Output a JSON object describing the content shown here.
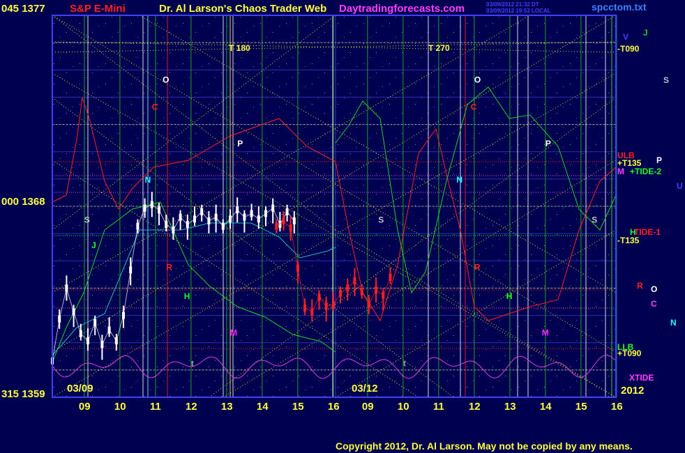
{
  "header": {
    "left_axis_top": "045  1377",
    "symbol": "S&P E-Mini",
    "title": "Dr. Al Larson's Chaos Trader Web",
    "site": "Daytradingforecasts.com",
    "stamp_line1": "03/09/2012 21:32 DT",
    "stamp_line2": "03/09/2012 19:53 LOCAL",
    "file": "spcctom.txt"
  },
  "axis": {
    "left_mid": "000  1368",
    "left_bottom": "315  1359",
    "date_left": "03/09",
    "date_mid": "03/12",
    "year": "2012",
    "hour_labels": [
      "09",
      "10",
      "11",
      "12",
      "13",
      "14",
      "15",
      "16",
      "09",
      "10",
      "11",
      "12",
      "13",
      "14",
      "15",
      "16"
    ]
  },
  "markers": {
    "t180": "T   180",
    "t270": "T   270"
  },
  "right_labels": {
    "v": "V",
    "j": "J",
    "t090_top": "-T090",
    "s": "S",
    "ulb": "ULB",
    "t135_pos": "+T135",
    "p": "P",
    "m": "M",
    "tide2": "+TIDE-2",
    "u": "U",
    "tide1": "TIDE-1",
    "h_right": "H",
    "t135_neg": "-T135",
    "r": "R",
    "o": "O",
    "c": "C",
    "n": "N",
    "llb": "LLB",
    "t090_bot": "+T090",
    "xtide": "XTIDE"
  },
  "chart_letters": [
    {
      "text": "O",
      "day": 1,
      "hour": 11.2,
      "price": 1374.8,
      "color": "#ffffff"
    },
    {
      "text": "C",
      "day": 1,
      "hour": 10.9,
      "price": 1373.3,
      "color": "#ff2020"
    },
    {
      "text": "P",
      "day": 1,
      "hour": 13.3,
      "price": 1371.3,
      "color": "#ffffff"
    },
    {
      "text": "N",
      "day": 1,
      "hour": 10.7,
      "price": 1369.3,
      "color": "#20ffff"
    },
    {
      "text": "S",
      "day": 1,
      "hour": 9.0,
      "price": 1367.1,
      "color": "#c0c0c0"
    },
    {
      "text": "J",
      "day": 1,
      "hour": 9.2,
      "price": 1365.7,
      "color": "#20ff20"
    },
    {
      "text": "R",
      "day": 1,
      "hour": 11.3,
      "price": 1364.5,
      "color": "#ff2020"
    },
    {
      "text": "H",
      "day": 1,
      "hour": 11.8,
      "price": 1362.9,
      "color": "#20ff20"
    },
    {
      "text": "M",
      "day": 1,
      "hour": 13.1,
      "price": 1360.9,
      "color": "#ff20ff"
    },
    {
      "text": "t",
      "day": 1,
      "hour": 12.0,
      "price": 1359.2,
      "color": "#a0a0a0"
    },
    {
      "text": "O",
      "day": 2,
      "hour": 12.0,
      "price": 1374.8,
      "color": "#ffffff"
    },
    {
      "text": "C",
      "day": 2,
      "hour": 11.9,
      "price": 1373.3,
      "color": "#ff2020"
    },
    {
      "text": "P",
      "day": 2,
      "hour": 14.0,
      "price": 1371.3,
      "color": "#ffffff"
    },
    {
      "text": "N",
      "day": 2,
      "hour": 11.5,
      "price": 1369.3,
      "color": "#20ffff"
    },
    {
      "text": "S",
      "day": 2,
      "hour": 9.3,
      "price": 1367.1,
      "color": "#c0c0c0"
    },
    {
      "text": "S",
      "day": 2,
      "hour": 15.3,
      "price": 1367.1,
      "color": "#c0c0c0"
    },
    {
      "text": "R",
      "day": 2,
      "hour": 12.0,
      "price": 1364.5,
      "color": "#ff2020"
    },
    {
      "text": "H",
      "day": 2,
      "hour": 12.9,
      "price": 1362.9,
      "color": "#20ff20"
    },
    {
      "text": "M",
      "day": 2,
      "hour": 13.9,
      "price": 1360.9,
      "color": "#ff20ff"
    },
    {
      "text": "t",
      "day": 2,
      "hour": 10.0,
      "price": 1359.2,
      "color": "#a0a0a0"
    }
  ],
  "copyright": "Copyright 2012, Dr. Al Larson. May not be copied by any means.",
  "chart_data": {
    "type": "line",
    "title": "S&P E-Mini",
    "price_ticks": [
      1377,
      1368,
      1359
    ],
    "angle_ticks": [
      "045",
      "000",
      "315"
    ],
    "ylim": [
      1357.5,
      1378.5
    ],
    "sessions": [
      "03/09",
      "03/12"
    ],
    "hours": [
      9,
      10,
      11,
      12,
      13,
      14,
      15,
      16
    ],
    "series": [
      {
        "name": "price_fri",
        "color": "#ffffff",
        "points": [
          [
            8.1,
            1359.5
          ],
          [
            8.3,
            1361.8
          ],
          [
            8.5,
            1363.5
          ],
          [
            8.7,
            1362.2
          ],
          [
            8.9,
            1361.0
          ],
          [
            9.1,
            1360.6
          ],
          [
            9.3,
            1361.6
          ],
          [
            9.5,
            1360.4
          ],
          [
            9.7,
            1361.2
          ],
          [
            9.9,
            1360.6
          ],
          [
            10.1,
            1362.0
          ],
          [
            10.3,
            1364.5
          ],
          [
            10.5,
            1366.9
          ],
          [
            10.7,
            1367.9
          ],
          [
            10.9,
            1368.1
          ],
          [
            11.1,
            1367.8
          ],
          [
            11.3,
            1367.0
          ],
          [
            11.5,
            1366.7
          ],
          [
            11.7,
            1367.4
          ],
          [
            11.9,
            1367.0
          ],
          [
            12.1,
            1367.3
          ],
          [
            12.3,
            1367.7
          ],
          [
            12.5,
            1367.2
          ],
          [
            12.7,
            1367.4
          ],
          [
            12.9,
            1366.9
          ],
          [
            13.1,
            1367.3
          ],
          [
            13.3,
            1367.8
          ],
          [
            13.5,
            1367.4
          ],
          [
            13.7,
            1367.6
          ],
          [
            13.9,
            1367.3
          ],
          [
            14.1,
            1367.6
          ],
          [
            14.3,
            1367.9
          ],
          [
            14.5,
            1367.0
          ],
          [
            14.7,
            1367.7
          ],
          [
            14.9,
            1367.2
          ]
        ]
      },
      {
        "name": "price_fri_late",
        "color": "#ff2020",
        "points": [
          [
            14.4,
            1366.9
          ],
          [
            14.6,
            1367.2
          ],
          [
            14.8,
            1366.8
          ],
          [
            15.0,
            1364.6
          ],
          [
            15.2,
            1362.4
          ],
          [
            15.4,
            1362.2
          ],
          [
            15.6,
            1363.0
          ],
          [
            15.8,
            1362.5
          ],
          [
            16.0,
            1362.6
          ],
          [
            16.2,
            1363.2
          ],
          [
            16.4,
            1363.5
          ],
          [
            16.6,
            1363.9
          ],
          [
            16.8,
            1363.3
          ],
          [
            17.0,
            1362.6
          ],
          [
            17.2,
            1363.4
          ],
          [
            17.4,
            1363.1
          ],
          [
            17.6,
            1364.1
          ]
        ]
      }
    ]
  }
}
